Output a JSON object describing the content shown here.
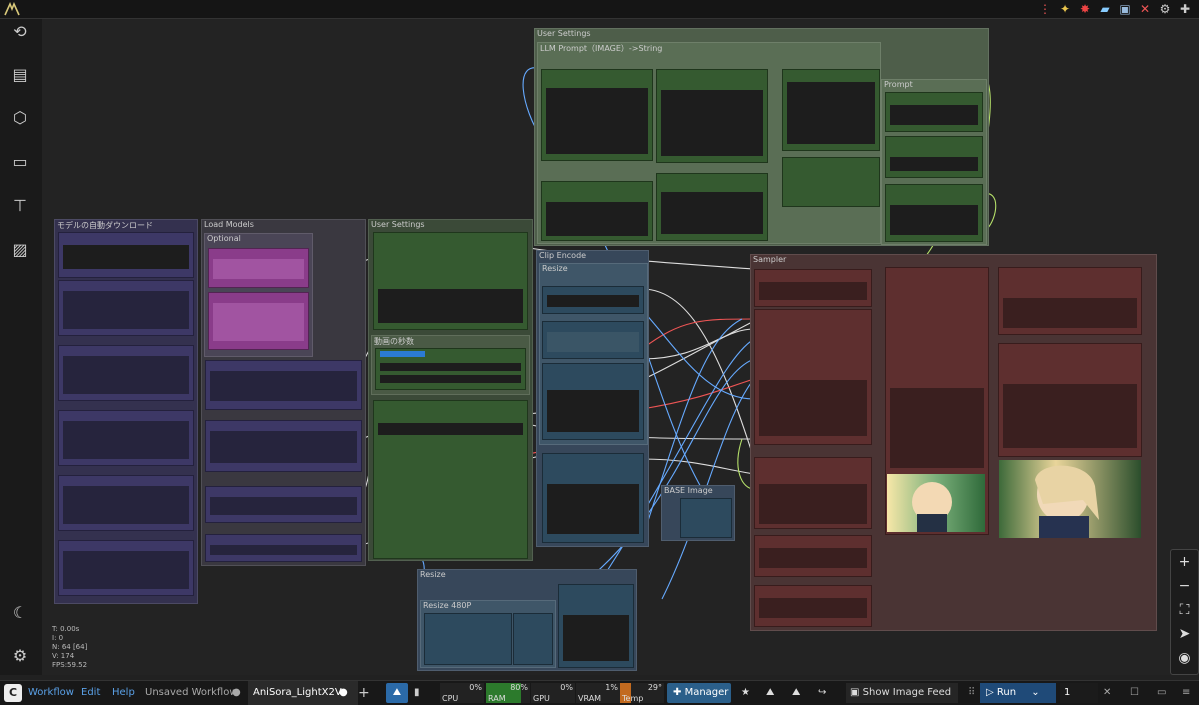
{
  "topbar": {
    "icons": [
      "comfy-logo-icon",
      "menu-dots-icon",
      "sparkle-icon",
      "star-burst-icon",
      "pill-icon",
      "monitor-icon",
      "close-x-icon",
      "gear-icon",
      "puzzle-icon"
    ]
  },
  "sidebar": {
    "icons": [
      "history-icon",
      "document-icon",
      "cube-icon",
      "folder-icon",
      "tree-icon",
      "image-icon",
      "moon-icon",
      "settings-icon"
    ]
  },
  "groups": {
    "download": "モデルの自動ダウンロード",
    "load_models": "Load Models",
    "optional": "Optional",
    "user_settings_1": "User Settings",
    "video_seconds": "動画の秒数",
    "user_settings_2": "User Settings",
    "llm_prompt": "LLM Prompt（IMAGE）->String",
    "prompt": "Prompt",
    "clip_encode": "Clip Encode",
    "resize_small": "Resize",
    "base_image": "BASE Image",
    "sampler": "Sampler",
    "resize_group": "Resize",
    "resize_480p": "Resize 480P"
  },
  "stats": {
    "t": "T: 0.00s",
    "i": "I: 0",
    "n": "N: 64 [64]",
    "v": "V: 174",
    "fps": "FPS:59.52"
  },
  "bottombar": {
    "workflow": "Workflow",
    "edit": "Edit",
    "help": "Help",
    "tab1": "Unsaved Workflow",
    "tab2": "AniSora_LightX2V",
    "cpu_label": "CPU",
    "cpu_val": "0%",
    "ram_label": "RAM",
    "ram_val": "80%",
    "gpu_label": "GPU",
    "gpu_val": "0%",
    "vram_label": "VRAM",
    "vram_val": "1%",
    "temp_label": "Temp",
    "temp_val": "29°",
    "manager": "Manager",
    "show_feed": "Show Image Feed",
    "run": "Run",
    "queue_count": "1"
  },
  "colors": {
    "green_node": "#355a30",
    "purple_node": "#3a3560",
    "magenta_node": "#8a3c8a",
    "blue_node": "#2d4a5e",
    "red_node": "#5e2f2f",
    "sampler_bg": "#4a3434",
    "accent": "#2b7bd4"
  },
  "zoom_controls": [
    "zoom-in-icon",
    "zoom-out-icon",
    "fit-view-icon",
    "pointer-icon",
    "eye-icon"
  ]
}
